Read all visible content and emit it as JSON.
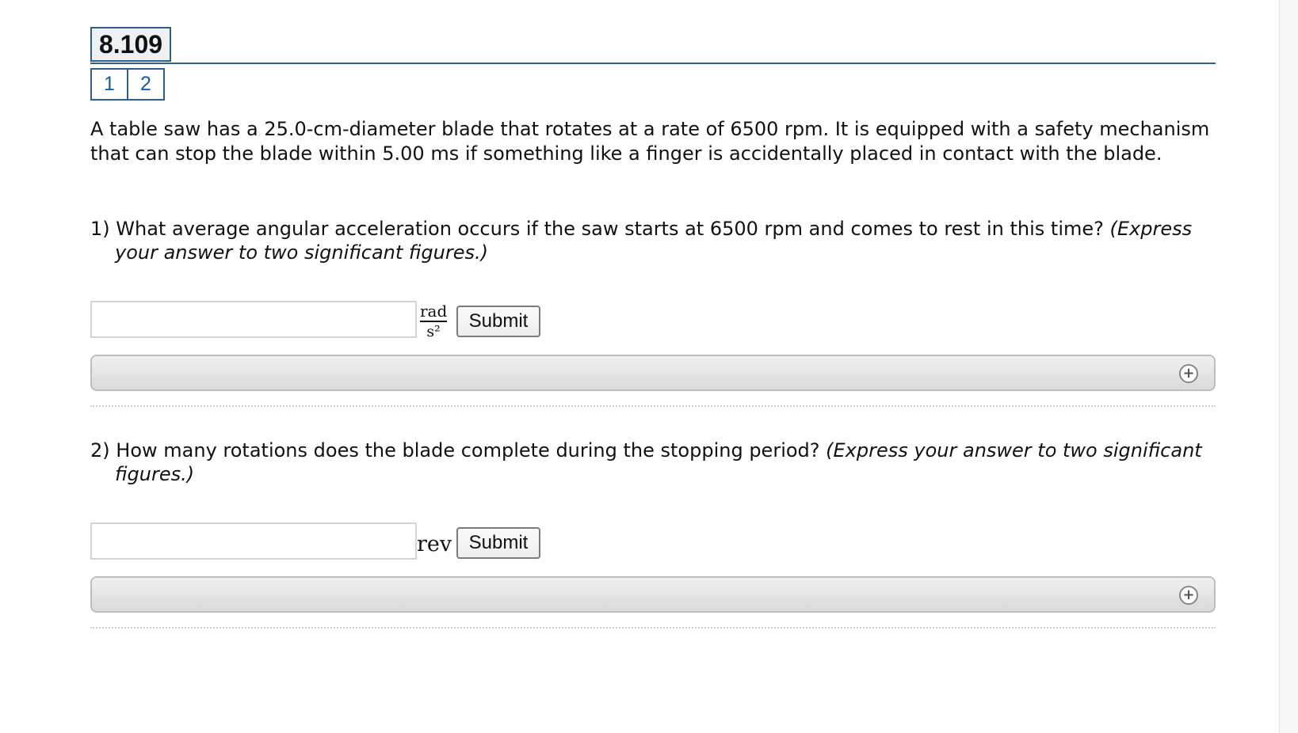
{
  "problem": {
    "title": "8.109",
    "parts": [
      "1",
      "2"
    ],
    "statement": "A table saw has a 25.0-cm-diameter blade that rotates at a rate of 6500 rpm. It is equipped with a safety mechanism that can stop the blade within 5.00 ms if something like a finger is accidentally placed in contact with the blade."
  },
  "questions": [
    {
      "number": "1)",
      "text": "What average angular acceleration occurs if the saw starts at 6500 rpm and comes to rest in this time?",
      "hint": "(Express your answer to two significant figures.)",
      "answer_value": "",
      "unit_numerator": "rad",
      "unit_denominator": "s²",
      "submit_label": "Submit",
      "expand_icon": "plus-circle-icon"
    },
    {
      "number": "2)",
      "text": "How many rotations does the blade complete during the stopping period?",
      "hint": "(Express your answer to two significant figures.)",
      "answer_value": "",
      "unit": "rev",
      "submit_label": "Submit",
      "expand_icon": "plus-circle-icon"
    }
  ],
  "colors": {
    "accent": "#2f5f8c",
    "tab_text": "#1a5c9c",
    "bar_top": "#f1f1f1",
    "bar_bottom": "#d9d9d9"
  }
}
